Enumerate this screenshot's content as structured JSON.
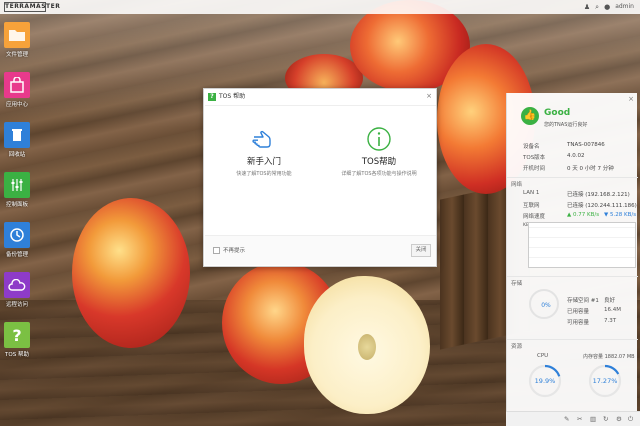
{
  "topbar": {
    "logo": "TERRAMASTER",
    "user": "admin"
  },
  "dock": [
    {
      "label": "文件管理",
      "icon": "folder-icon",
      "color": "#f7a23a",
      "glyph": "▭"
    },
    {
      "label": "应用中心",
      "icon": "shopping-bag-icon",
      "color": "#e83a8c",
      "glyph": "◓"
    },
    {
      "label": "回收站",
      "icon": "trash-icon",
      "color": "#2f80d9",
      "glyph": "🗑"
    },
    {
      "label": "控制面板",
      "icon": "sliders-icon",
      "color": "#3bb143",
      "glyph": "⫶"
    },
    {
      "label": "备份管理",
      "icon": "clock-icon",
      "color": "#2f80d9",
      "glyph": "◷"
    },
    {
      "label": "远程访问",
      "icon": "cloud-icon",
      "color": "#8e3bc8",
      "glyph": "☁"
    },
    {
      "label": "TOS 帮助",
      "icon": "question-icon",
      "color": "#7bc043",
      "glyph": "?"
    }
  ],
  "dialog": {
    "title": "TOS 帮助",
    "options": [
      {
        "title": "新手入门",
        "desc": "快速了解TOS的常用功能"
      },
      {
        "title": "TOS帮助",
        "desc": "详细了解TOS各项功能与操作说明"
      }
    ],
    "dont_show": "不再提示",
    "close_button": "关闭"
  },
  "status": {
    "title": "Good",
    "subtitle": "您的TNAS运行良好",
    "device": {
      "label": "设备名",
      "value": "TNAS-007846"
    },
    "version": {
      "label": "TOS版本",
      "value": "4.0.02"
    },
    "uptime": {
      "label": "开机时间",
      "value": "0 天 0 小时 7 分钟"
    },
    "network": {
      "section": "网络",
      "lan": {
        "label": "LAN 1",
        "value": "已连接 (192.168.2.121)"
      },
      "internet": {
        "label": "互联网",
        "value": "已连接 (120.244.111.186)"
      },
      "speed_label": "网络速度",
      "upload": "▲ 0.77 KB/s",
      "download": "▼ 5.28 KB/s",
      "unit": "KB/s"
    },
    "storage": {
      "section": "存储",
      "percent": "0%",
      "pool": {
        "label": "存储空间 #1",
        "value": "良好"
      },
      "used": {
        "label": "已用容量",
        "value": "16.4M"
      },
      "available": {
        "label": "可用容量",
        "value": "7.3T"
      }
    },
    "resources": {
      "section": "资源",
      "cpu_label": "CPU",
      "cpu": "19.9%",
      "cpu_value": 19.9,
      "memory_label": "内存容量 1882.07 MB",
      "memory": "17.27%",
      "memory_value": 17.27
    }
  },
  "bottombar": {
    "icons": [
      "pin-icon",
      "wrench-icon",
      "trash-icon",
      "refresh-icon",
      "settings-icon",
      "power-icon"
    ]
  },
  "colors": {
    "accent": "#3bb143",
    "blue": "#2f80d9"
  }
}
